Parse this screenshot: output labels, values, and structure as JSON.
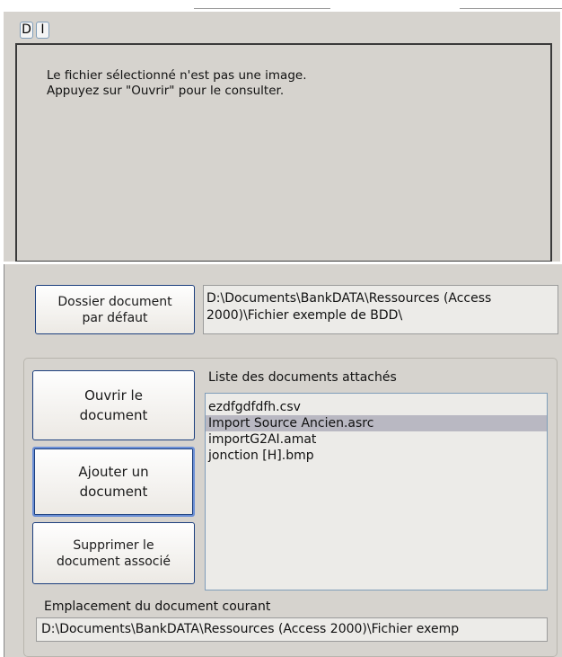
{
  "toolbar": {
    "d_label": "D",
    "i_label": "I"
  },
  "preview": {
    "line1": "Le fichier sélectionné n'est pas une image.",
    "line2": "Appuyez sur \"Ouvrir\" pour le consulter."
  },
  "default_folder": {
    "button_label": "Dossier document\npar défaut",
    "path": "D:\\Documents\\BankDATA\\Ressources (Access 2000)\\Fichier exemple de BDD\\"
  },
  "actions": {
    "open_label": "Ouvrir le\ndocument",
    "add_label": "Ajouter un\ndocument",
    "delete_label": "Supprimer le\ndocument associé"
  },
  "attached": {
    "title": "Liste des documents attachés",
    "items": [
      "ezdfgdfdfh.csv",
      "Import Source Ancien.asrc",
      "importG2AI.amat",
      "jonction [H].bmp"
    ],
    "selected_index": 1
  },
  "current_location": {
    "label": "Emplacement du document courant",
    "path": "D:\\Documents\\BankDATA\\Ressources (Access 2000)\\Fichier exemp"
  },
  "colors": {
    "panel_bg": "#d6d3ce",
    "field_bg": "#ecebe8",
    "button_border": "#1c3f7e",
    "selection_bg": "#b9b8c2"
  }
}
